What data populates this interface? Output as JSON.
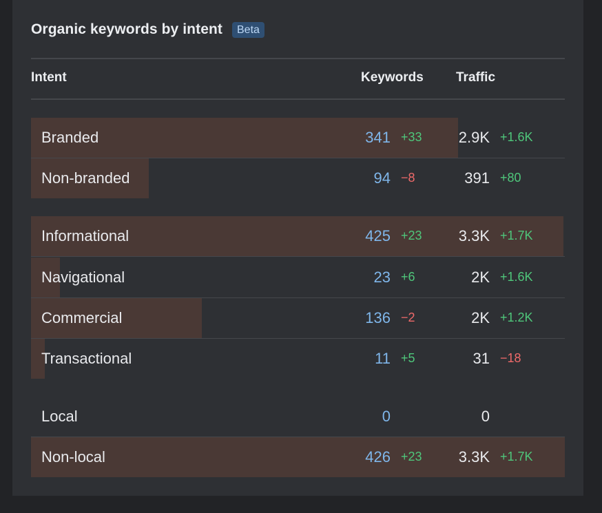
{
  "widget": {
    "title": "Organic keywords by intent",
    "badge": "Beta"
  },
  "table": {
    "headers": {
      "intent": "Intent",
      "keywords": "Keywords",
      "traffic": "Traffic"
    },
    "rows": [
      {
        "label": "Branded",
        "keywords": "341",
        "keywords_delta": "+33",
        "keywords_delta_sign": "pos",
        "traffic": "2.9K",
        "traffic_delta": "+1.6K",
        "traffic_delta_sign": "pos",
        "share": 0.8
      },
      {
        "label": "Non-branded",
        "keywords": "94",
        "keywords_delta": "−8",
        "keywords_delta_sign": "neg",
        "traffic": "391",
        "traffic_delta": "+80",
        "traffic_delta_sign": "pos",
        "share": 0.22
      },
      {
        "label": "Informational",
        "keywords": "425",
        "keywords_delta": "+23",
        "keywords_delta_sign": "pos",
        "traffic": "3.3K",
        "traffic_delta": "+1.7K",
        "traffic_delta_sign": "pos",
        "share": 1.0
      },
      {
        "label": "Navigational",
        "keywords": "23",
        "keywords_delta": "+6",
        "keywords_delta_sign": "pos",
        "traffic": "2K",
        "traffic_delta": "+1.6K",
        "traffic_delta_sign": "pos",
        "share": 0.054
      },
      {
        "label": "Commercial",
        "keywords": "136",
        "keywords_delta": "−2",
        "keywords_delta_sign": "neg",
        "traffic": "2K",
        "traffic_delta": "+1.2K",
        "traffic_delta_sign": "pos",
        "share": 0.32
      },
      {
        "label": "Transactional",
        "keywords": "11",
        "keywords_delta": "+5",
        "keywords_delta_sign": "pos",
        "traffic": "31",
        "traffic_delta": "−18",
        "traffic_delta_sign": "neg",
        "share": 0.026
      },
      {
        "label": "Local",
        "keywords": "0",
        "keywords_delta": "",
        "keywords_delta_sign": "pos",
        "traffic": "0",
        "traffic_delta": "",
        "traffic_delta_sign": "pos",
        "share": 0.0
      },
      {
        "label": "Non-local",
        "keywords": "426",
        "keywords_delta": "+23",
        "keywords_delta_sign": "pos",
        "traffic": "3.3K",
        "traffic_delta": "+1.7K",
        "traffic_delta_sign": "pos",
        "share": 1.0
      }
    ]
  },
  "colors": {
    "bar": "#4a3935",
    "keywords_value": "#7fb6ea",
    "positive": "#4fc77b",
    "negative": "#f06a6a",
    "badge_bg": "#2f4f73"
  }
}
